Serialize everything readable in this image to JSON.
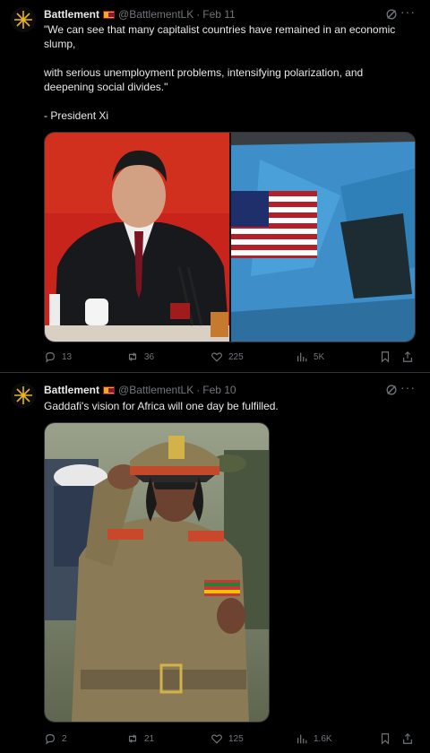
{
  "tweets": [
    {
      "name": "Battlement",
      "handle": "@BattlementLK",
      "dot": "·",
      "date": "Feb 11",
      "text": "\"We can see that many capitalist countries have remained in an economic slump,\n\nwith serious unemployment problems, intensifying polarization, and deepening social divides.\"\n\n- President Xi",
      "stats": {
        "replies": "13",
        "reposts": "36",
        "likes": "225",
        "views": "5K"
      }
    },
    {
      "name": "Battlement",
      "handle": "@BattlementLK",
      "dot": "·",
      "date": "Feb 10",
      "text": "Gaddafi's vision for Africa will one day be fulfilled.",
      "stats": {
        "replies": "2",
        "reposts": "21",
        "likes": "125",
        "views": "1.6K"
      }
    }
  ],
  "more_label": "···",
  "colors": {
    "background": "#000000",
    "text": "#e7e9ea",
    "muted": "#71767b",
    "border": "#2f3336"
  }
}
